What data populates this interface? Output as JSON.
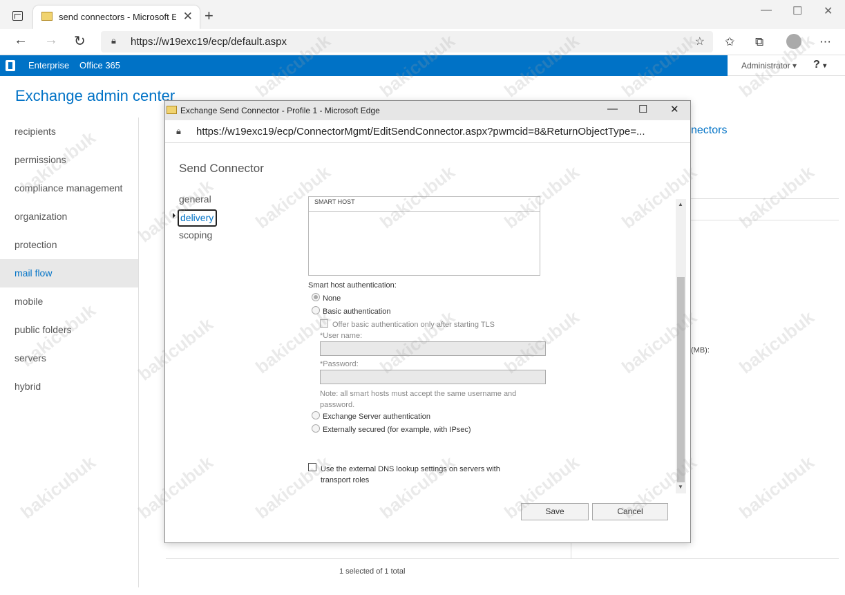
{
  "browser": {
    "tab_title": "send connectors - Microsoft Excl",
    "url": "https://w19exc19/ecp/default.aspx"
  },
  "eac": {
    "top_links": [
      "Enterprise",
      "Office 365"
    ],
    "admin": "Administrator",
    "help": "?",
    "title": "Exchange admin center",
    "nav": [
      "recipients",
      "permissions",
      "compliance management",
      "organization",
      "protection",
      "mail flow",
      "mobile",
      "public folders",
      "servers",
      "hybrid"
    ],
    "active_nav": "mail flow",
    "bg_link": "nectors",
    "bg_mb": "(MB):",
    "selection_count": "1 selected of 1 total"
  },
  "popup": {
    "window_title": "Exchange Send Connector - Profile 1 - Microsoft Edge",
    "url": "https://w19exc19/ecp/ConnectorMgmt/EditSendConnector.aspx?pwmcid=8&ReturnObjectType=...",
    "heading": "Send Connector",
    "tabs": [
      "general",
      "delivery",
      "scoping"
    ],
    "selected_tab": "delivery",
    "smart_host_header": "SMART HOST",
    "auth_label": "Smart host authentication:",
    "auth_options": {
      "none": "None",
      "basic": "Basic authentication",
      "offer_tls": "Offer basic authentication only after starting TLS",
      "username": "*User name:",
      "password": "*Password:",
      "note": "Note: all smart hosts must accept the same username and password.",
      "exchange": "Exchange Server authentication",
      "external": "Externally secured (for example, with IPsec)"
    },
    "selected_auth": "None",
    "dns_checkbox": "Use the external DNS lookup settings on servers with transport roles",
    "dns_checked": false,
    "save": "Save",
    "cancel": "Cancel"
  },
  "watermark": "bakicubuk"
}
